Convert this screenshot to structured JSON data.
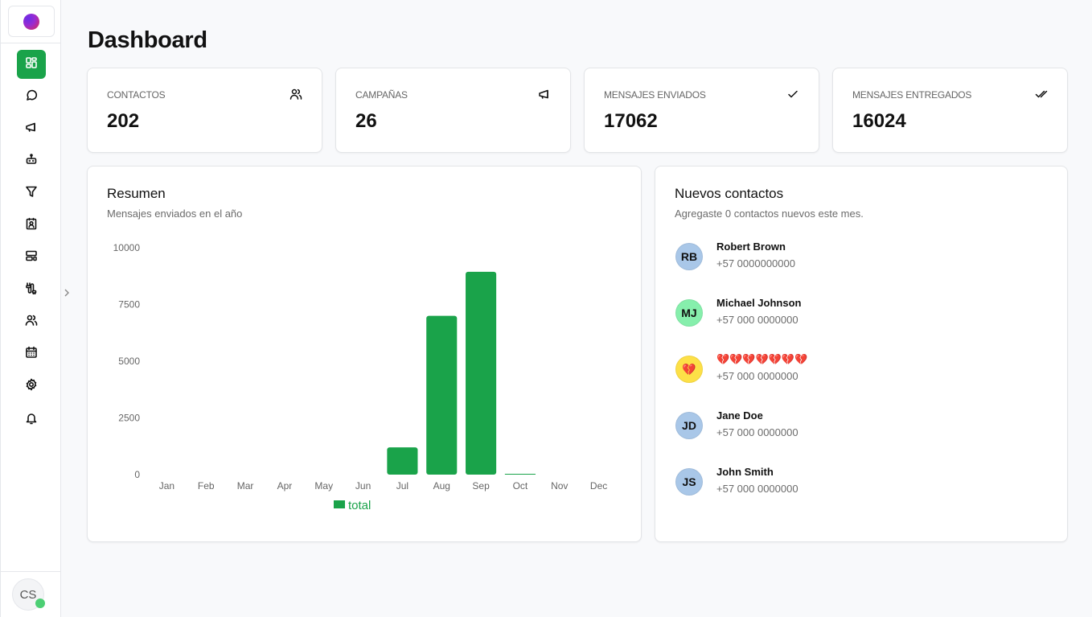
{
  "app": {
    "logo": "brand-logo",
    "collapse_icon": "chevron-right-icon",
    "user": {
      "initials": "CS",
      "status": "online",
      "status_color": "#4ccf74"
    },
    "accent_color": "#1aa34a"
  },
  "sidebar": {
    "items": [
      {
        "name": "dashboard",
        "icon": "grid-icon",
        "active": true
      },
      {
        "name": "chats",
        "icon": "message-circle-icon",
        "active": false
      },
      {
        "name": "campaigns",
        "icon": "megaphone-icon",
        "active": false
      },
      {
        "name": "bots",
        "icon": "bot-icon",
        "active": false
      },
      {
        "name": "funnels",
        "icon": "filter-icon",
        "active": false
      },
      {
        "name": "contacts-book",
        "icon": "contact-card-icon",
        "active": false
      },
      {
        "name": "templates",
        "icon": "layout-icon",
        "active": false
      },
      {
        "name": "integrations",
        "icon": "cable-icon",
        "active": false
      },
      {
        "name": "users",
        "icon": "users-icon",
        "active": false
      },
      {
        "name": "calendar",
        "icon": "calendar-icon",
        "active": false
      },
      {
        "name": "settings",
        "icon": "gear-icon",
        "active": false
      },
      {
        "name": "notifications",
        "icon": "bell-icon",
        "active": false
      }
    ]
  },
  "header": {
    "title": "Dashboard"
  },
  "stats": [
    {
      "label": "CONTACTOS",
      "value": "202",
      "icon": "users-icon"
    },
    {
      "label": "CAMPAÑAS",
      "value": "26",
      "icon": "megaphone-icon"
    },
    {
      "label": "MENSAJES ENVIADOS",
      "value": "17062",
      "icon": "check-icon"
    },
    {
      "label": "MENSAJES ENTREGADOS",
      "value": "16024",
      "icon": "double-check-icon"
    }
  ],
  "summary": {
    "title": "Resumen",
    "subtitle": "Mensajes enviados en el año"
  },
  "chart_data": {
    "type": "bar",
    "title": "Resumen",
    "subtitle": "Mensajes enviados en el año",
    "categories": [
      "Jan",
      "Feb",
      "Mar",
      "Apr",
      "May",
      "Jun",
      "Jul",
      "Aug",
      "Sep",
      "Oct",
      "Nov",
      "Dec"
    ],
    "series": [
      {
        "name": "total",
        "color": "#1aa34a",
        "values": [
          0,
          0,
          0,
          0,
          0,
          0,
          1200,
          7000,
          8940,
          30,
          0,
          0
        ]
      }
    ],
    "yticks": [
      0,
      2500,
      5000,
      7500,
      10000
    ],
    "ylim": [
      0,
      10000
    ],
    "xlabel": "",
    "ylabel": "",
    "grid": false,
    "legend": "bottom-center"
  },
  "new_contacts": {
    "title": "Nuevos contactos",
    "subtitle": "Agregaste 0 contactos nuevos este mes.",
    "items": [
      {
        "initials": "RB",
        "name": "Robert Brown",
        "phone": "+57 0000000000",
        "color": "#a9c7e8"
      },
      {
        "initials": "MJ",
        "name": "Michael Johnson",
        "phone": "+57 000 0000000",
        "color": "#86efac"
      },
      {
        "initials": "💔",
        "name": "💔💔💔💔💔💔💔",
        "phone": "+57 000 0000000",
        "color": "#fde047"
      },
      {
        "initials": "JD",
        "name": "Jane Doe",
        "phone": "+57 000 0000000",
        "color": "#a9c7e8"
      },
      {
        "initials": "JS",
        "name": "John Smith",
        "phone": "+57 000 0000000",
        "color": "#a9c7e8"
      }
    ]
  }
}
